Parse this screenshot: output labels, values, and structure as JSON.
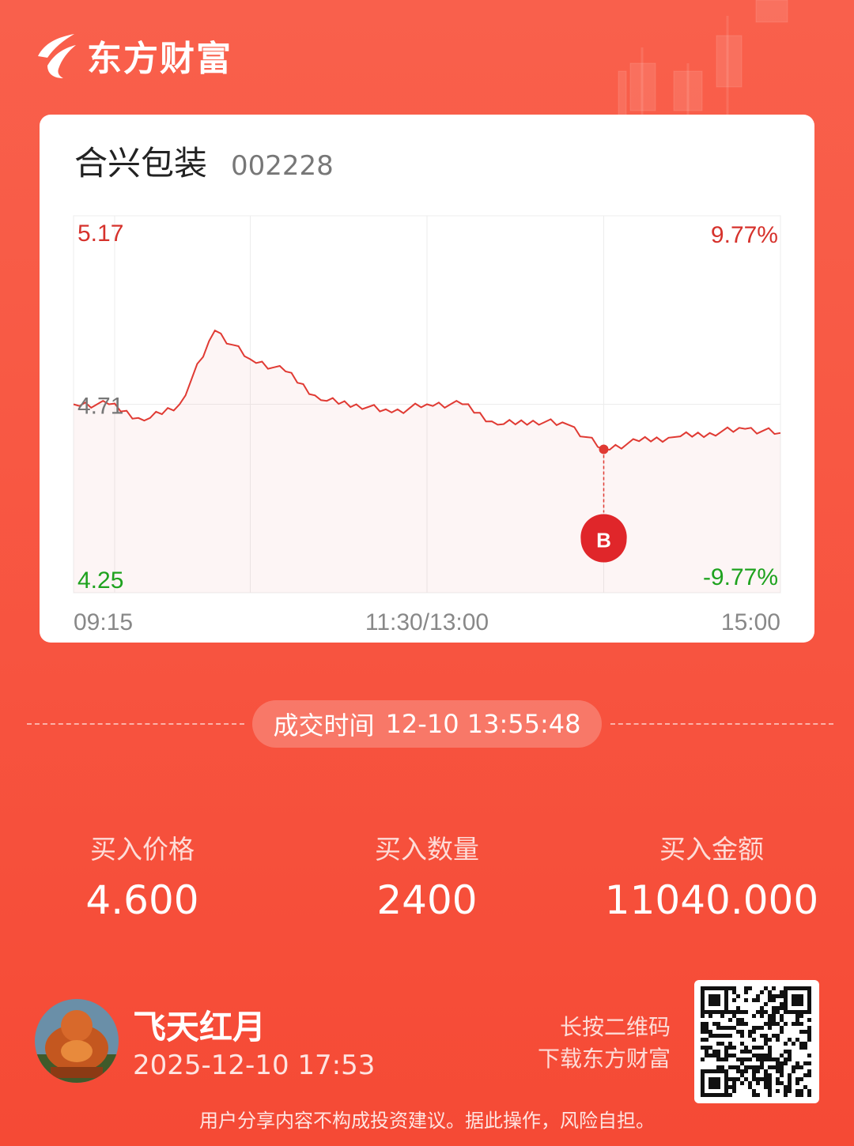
{
  "brand": {
    "name": "东方财富"
  },
  "stock": {
    "name": "合兴包装",
    "code": "002228"
  },
  "chart_data": {
    "type": "line",
    "x": [
      "09:15",
      "09:30",
      "09:33",
      "09:40",
      "09:50",
      "10:00",
      "10:15",
      "10:30",
      "10:45",
      "11:00",
      "11:15",
      "11:30/13:00",
      "13:15",
      "13:30",
      "13:45",
      "13:55",
      "14:05",
      "14:15",
      "14:30",
      "14:45",
      "15:00"
    ],
    "y": [
      4.71,
      4.71,
      4.67,
      4.71,
      4.89,
      4.82,
      4.79,
      4.72,
      4.71,
      4.69,
      4.71,
      4.71,
      4.66,
      4.67,
      4.66,
      4.6,
      4.62,
      4.63,
      4.64,
      4.65,
      4.64
    ],
    "ylim": [
      4.25,
      5.17
    ],
    "prev_close": 4.71,
    "y_tick_labels": {
      "top": "5.17",
      "mid": "4.71",
      "bottom": "4.25"
    },
    "pct_labels": {
      "top": "9.77%",
      "bottom": "-9.77%"
    },
    "x_tick_labels": [
      "09:15",
      "11:30/13:00",
      "15:00"
    ],
    "grid": true,
    "line_color": "#e03a33",
    "up_color": "#d6322c",
    "down_color": "#1ea21e",
    "marker": {
      "label": "B",
      "x": "13:55",
      "y": 4.6
    }
  },
  "trade": {
    "time_label": "成交时间",
    "time_value": "12-10 13:55:48"
  },
  "stats": [
    {
      "label": "买入价格",
      "value": "4.600"
    },
    {
      "label": "买入数量",
      "value": "2400"
    },
    {
      "label": "买入金额",
      "value": "11040.000"
    }
  ],
  "user": {
    "name": "飞天红月",
    "date": "2025-12-10 17:53"
  },
  "qr": {
    "hint_line1": "长按二维码",
    "hint_line2": "下载东方财富"
  },
  "disclaimer": "用户分享内容不构成投资建议。据此操作，风险自担。"
}
